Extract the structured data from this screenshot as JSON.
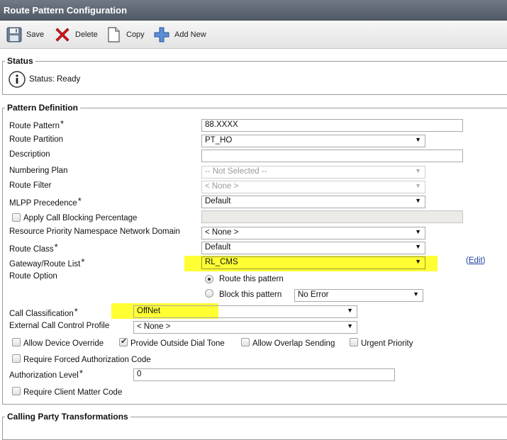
{
  "window": {
    "title": "Route Pattern Configuration"
  },
  "toolbar": {
    "save_label": "Save",
    "delete_label": "Delete",
    "copy_label": "Copy",
    "add_new_label": "Add New"
  },
  "status": {
    "legend": "Status",
    "text": "Status: Ready"
  },
  "pattern": {
    "legend": "Pattern Definition",
    "route_pattern": {
      "label": "Route Pattern",
      "value": "88.XXXX"
    },
    "route_partition": {
      "label": "Route Partition",
      "value": "PT_HO"
    },
    "description": {
      "label": "Description",
      "value": ""
    },
    "numbering_plan": {
      "label": "Numbering Plan",
      "value": "-- Not Selected --"
    },
    "route_filter": {
      "label": "Route Filter",
      "value": "< None >"
    },
    "mlpp": {
      "label": "MLPP Precedence",
      "value": "Default"
    },
    "call_blocking": {
      "label": "Apply Call Blocking Percentage",
      "value": ""
    },
    "rpnd": {
      "label": "Resource Priority Namespace Network Domain",
      "value": "< None >"
    },
    "route_class": {
      "label": "Route Class",
      "value": "Default"
    },
    "gateway": {
      "label": "Gateway/Route List",
      "value": "RL_CMS",
      "edit_open": "(",
      "edit_link": "Edit",
      "edit_close": ")"
    },
    "route_option": {
      "label": "Route Option",
      "route_this": "Route this pattern",
      "block_this": "Block this pattern",
      "block_reason": "No Error"
    },
    "call_classification": {
      "label": "Call Classification",
      "value": "OffNet"
    },
    "ext_call_control": {
      "label": "External Call Control Profile",
      "value": "< None >"
    },
    "allow_device_override": "Allow Device Override",
    "provide_outside_dial_tone": "Provide Outside Dial Tone",
    "allow_overlap_sending": "Allow Overlap Sending",
    "urgent_priority": "Urgent Priority",
    "require_fac": "Require Forced Authorization Code",
    "auth_level": {
      "label": "Authorization Level",
      "value": "0"
    },
    "require_cmc": "Require Client Matter Code",
    "required_marker": "*"
  },
  "calling_party": {
    "legend": "Calling Party Transformations"
  },
  "colors": {
    "highlight": "#ffff33",
    "link": "#1a3fa0"
  }
}
